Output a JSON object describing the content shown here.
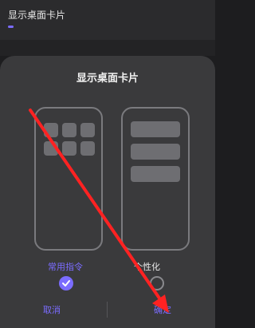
{
  "topbar": {
    "title": "显示桌面卡片"
  },
  "dialog": {
    "title": "显示桌面卡片",
    "options": [
      {
        "label": "常用指令",
        "selected": true
      },
      {
        "label": "个性化",
        "selected": false
      }
    ],
    "cancel_label": "取消",
    "confirm_label": "确定"
  },
  "colors": {
    "accent": "#7b6cff",
    "annotation_arrow": "#ff2222"
  }
}
